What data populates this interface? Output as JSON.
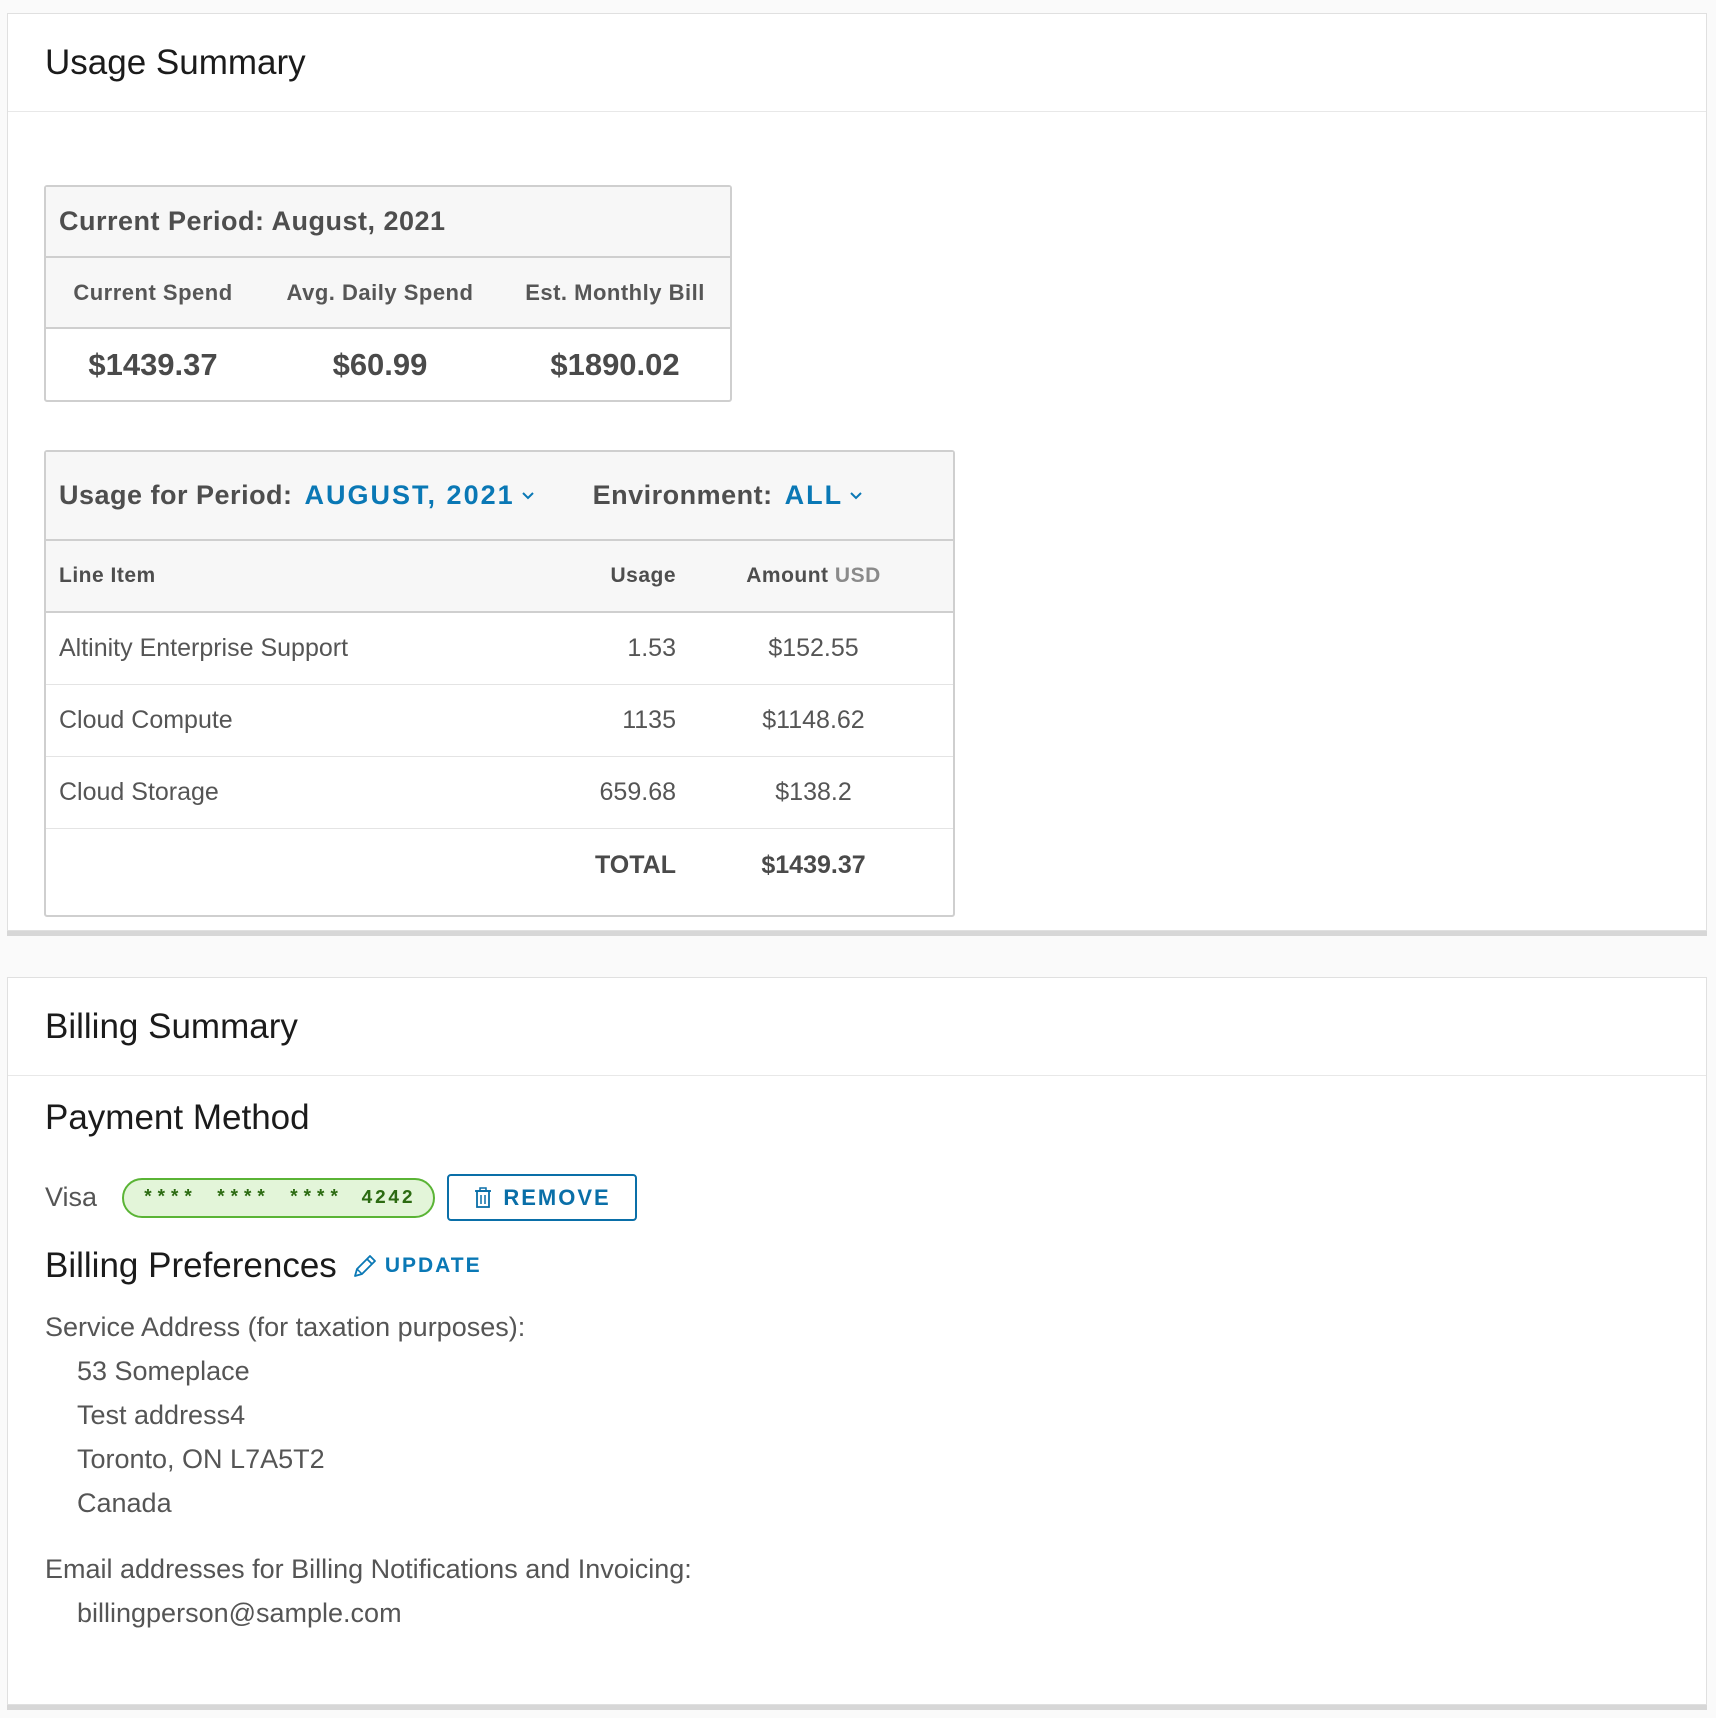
{
  "usage_summary": {
    "title": "Usage Summary",
    "period": {
      "heading": "Current Period: August, 2021",
      "columns": [
        "Current Spend",
        "Avg. Daily Spend",
        "Est. Monthly Bill"
      ],
      "values": [
        "$1439.37",
        "$60.99",
        "$1890.02"
      ]
    },
    "filters": {
      "period_label": "Usage for Period:",
      "period_value": "AUGUST, 2021",
      "env_label": "Environment:",
      "env_value": "ALL"
    },
    "table": {
      "headers": {
        "item": "Line Item",
        "usage": "Usage",
        "amount": "Amount",
        "currency": "USD"
      },
      "rows": [
        {
          "item": "Altinity Enterprise Support",
          "usage": "1.53",
          "amount": "$152.55"
        },
        {
          "item": "Cloud Compute",
          "usage": "1135",
          "amount": "$1148.62"
        },
        {
          "item": "Cloud Storage",
          "usage": "659.68",
          "amount": "$138.2"
        }
      ],
      "total_label": "TOTAL",
      "total_amount": "$1439.37"
    }
  },
  "billing_summary": {
    "title": "Billing Summary",
    "payment_method": {
      "title": "Payment Method",
      "brand": "Visa",
      "masked_number": "**** **** **** 4242",
      "remove_label": "REMOVE"
    },
    "preferences": {
      "title": "Billing Preferences",
      "update_label": "UPDATE",
      "address_label": "Service Address (for taxation purposes):",
      "address_lines": [
        "53 Someplace",
        "Test address4",
        "Toronto, ON L7A5T2",
        "Canada"
      ],
      "email_label": "Email addresses for Billing Notifications and Invoicing:",
      "emails": [
        "billingperson@sample.com"
      ]
    }
  },
  "colors": {
    "accent": "#0a78b5",
    "pill_border": "#5ab435",
    "pill_bg": "#e3f5d9"
  },
  "icons": {
    "dropdown": "chevron-down-icon",
    "remove": "trash-icon",
    "update": "pencil-icon"
  }
}
